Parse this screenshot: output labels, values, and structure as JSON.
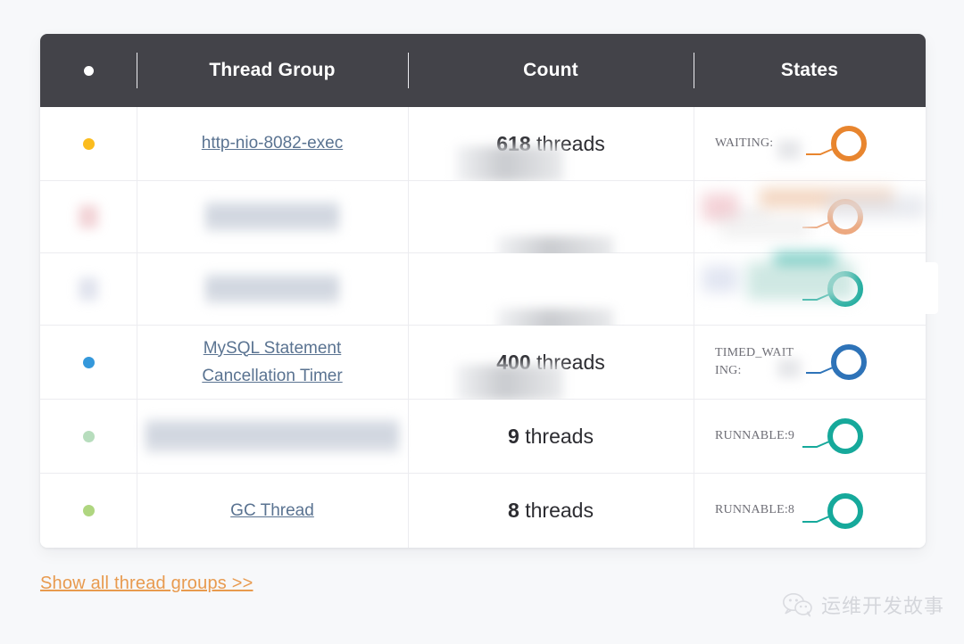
{
  "card": {
    "header": {
      "dot_label": "status-dot",
      "columns": [
        "Thread Group",
        "Count",
        "States"
      ]
    },
    "rows": [
      {
        "id": "row-1",
        "dot_color": "#fbbc1e",
        "group": "http-nio-8082-exec",
        "group_redacted": false,
        "count_number": "618",
        "count_unit": "threads",
        "count_redacted_prefix": true,
        "state_label": "WAITING:",
        "state_value_redacted": true,
        "ring_color": "#e8852e",
        "row_redacted": false
      },
      {
        "id": "row-2",
        "dot_color": "#e8b0b6",
        "group": "",
        "group_redacted": true,
        "count_number": "",
        "count_unit": "",
        "count_redacted_prefix": true,
        "state_label": "WAITING:",
        "state_value_redacted": true,
        "ring_color": "#eda87e",
        "row_redacted": true
      },
      {
        "id": "row-3",
        "dot_color": "#c8cde0",
        "group": "",
        "group_redacted": true,
        "count_number": "",
        "count_unit": "",
        "count_redacted_prefix": true,
        "state_label": "",
        "state_value_redacted": true,
        "ring_color": "#16a99b",
        "row_redacted": true
      },
      {
        "id": "row-4",
        "dot_color": "#3498db",
        "group": "MySQL Statement Cancellation Timer",
        "group_redacted": false,
        "count_number": "400",
        "count_unit": "threads",
        "count_redacted_prefix": true,
        "state_label": "TIMED_WAITING:",
        "state_value_redacted": true,
        "ring_color": "#2e73b8",
        "row_redacted": false
      },
      {
        "id": "row-5",
        "dot_color": "#b7ddbd",
        "group": "",
        "group_redacted": true,
        "count_number": "9",
        "count_unit": "threads",
        "count_redacted_prefix": false,
        "state_label": "RUNNABLE:9",
        "state_value_redacted": false,
        "ring_color": "#16a99b",
        "row_redacted": false
      },
      {
        "id": "row-6",
        "dot_color": "#afd680",
        "group": "GC Thread",
        "group_redacted": false,
        "count_number": "8",
        "count_unit": "threads",
        "count_redacted_prefix": false,
        "state_label": "RUNNABLE:8",
        "state_value_redacted": false,
        "ring_color": "#16a99b",
        "row_redacted": false
      }
    ]
  },
  "footer": {
    "show_all_label": "Show all thread groups >>"
  },
  "watermark": {
    "text": "运维开发故事",
    "icon": "wechat-icon"
  },
  "colors": {
    "header_bg": "#434349",
    "page_bg": "#f7f8fa",
    "link": "#5a7391",
    "accent_orange": "#e89a4e",
    "divider": "#ececf0"
  }
}
